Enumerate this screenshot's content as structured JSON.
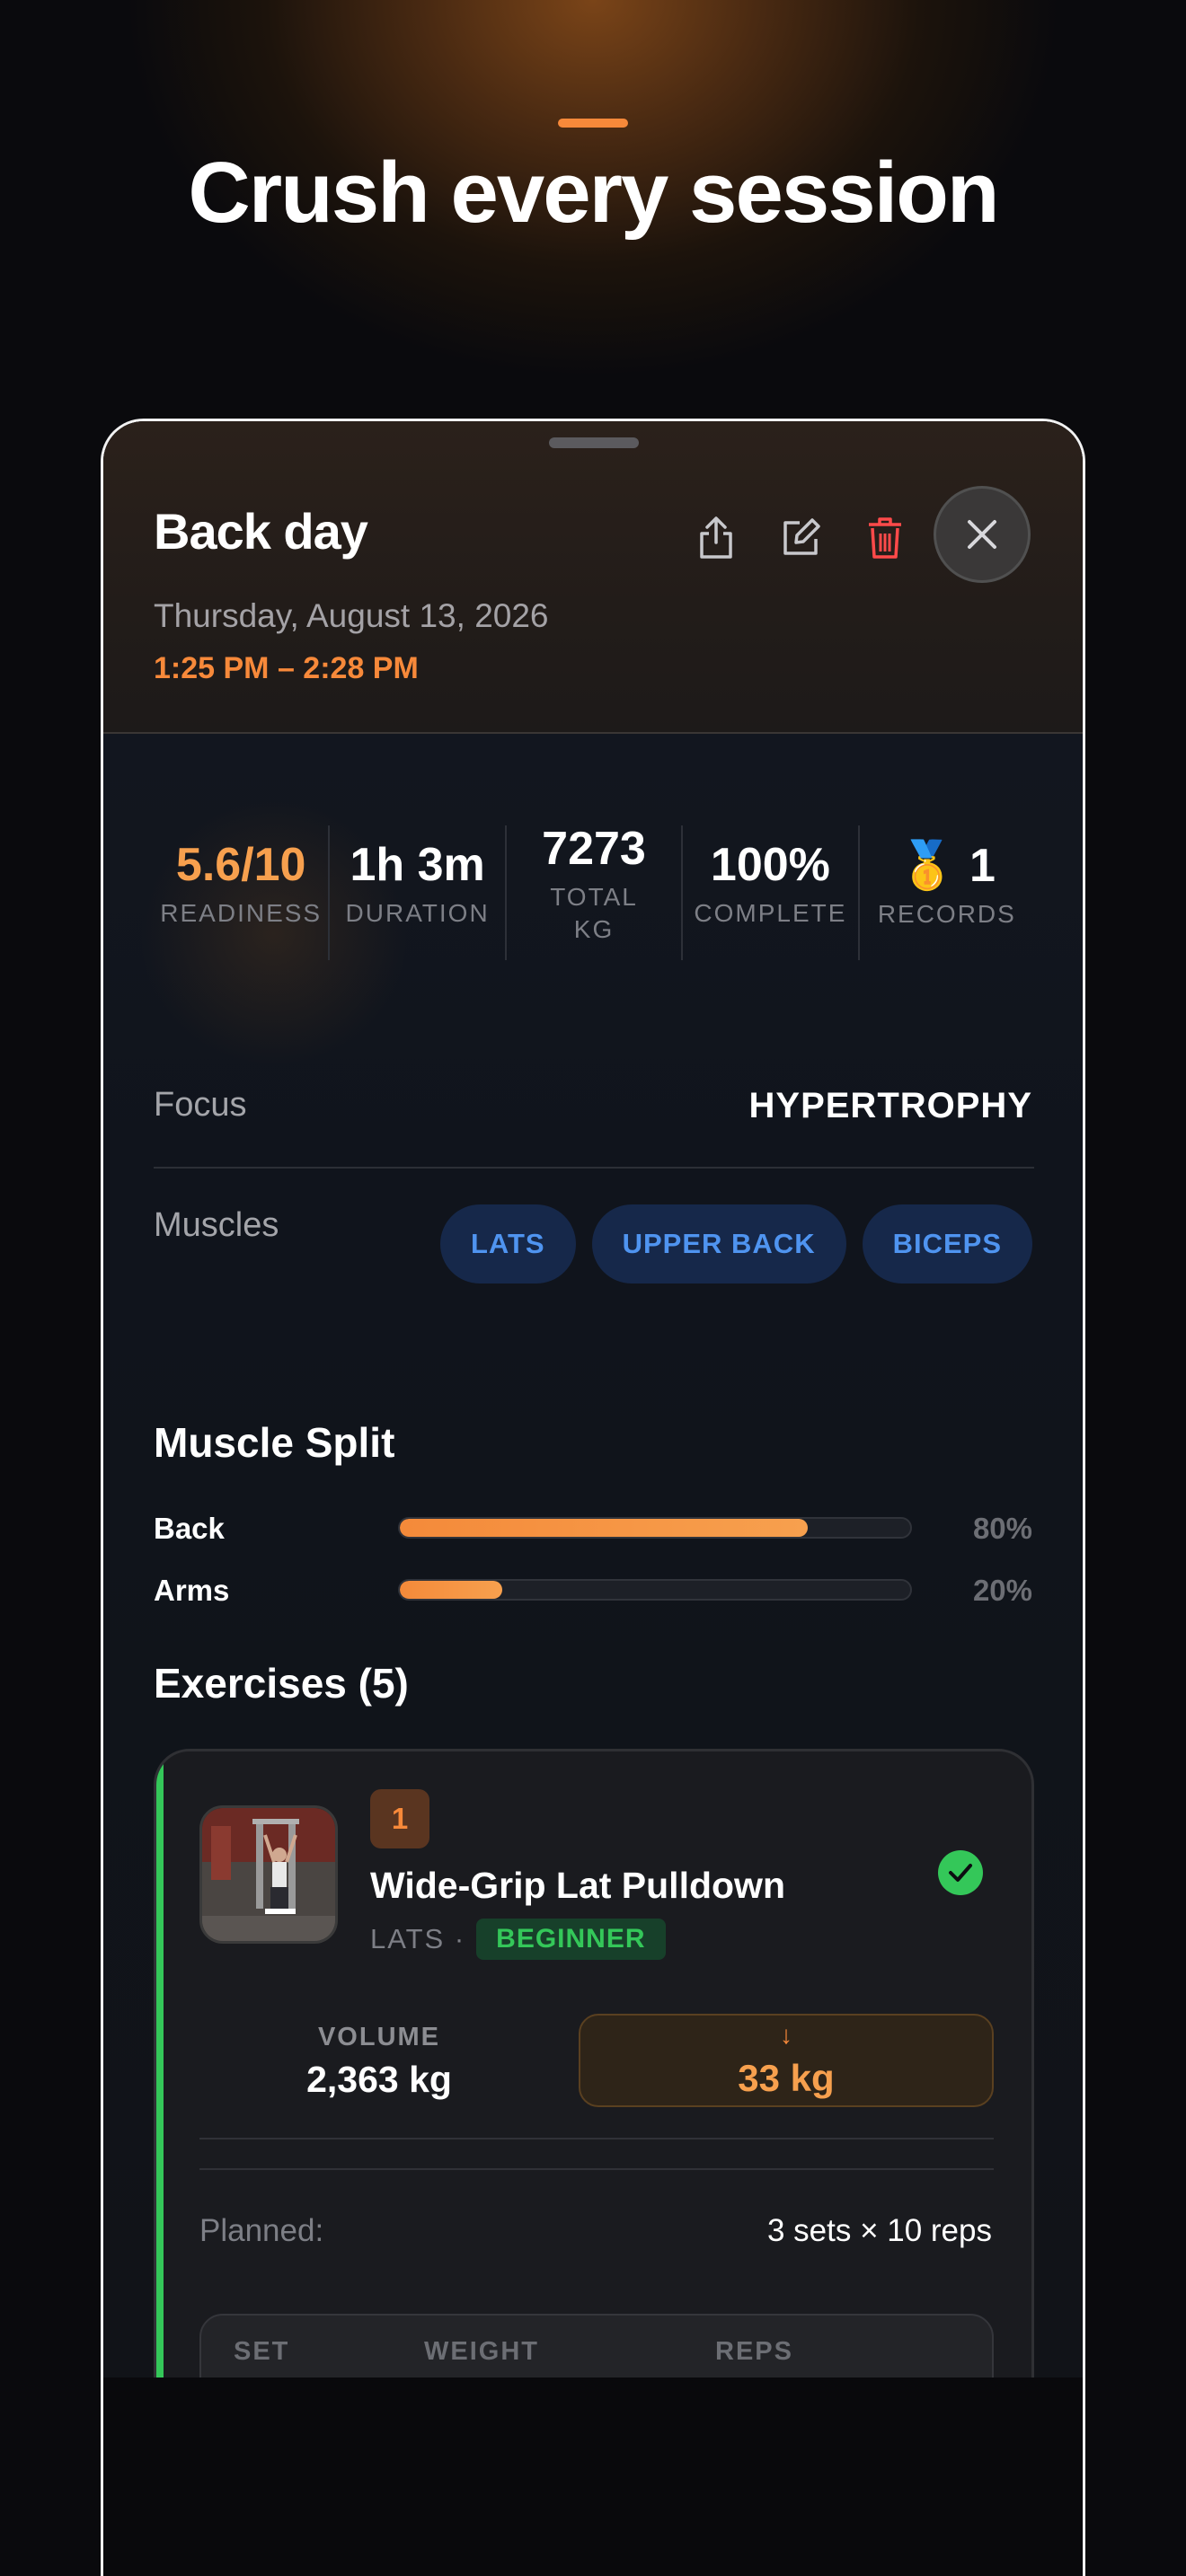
{
  "hero": {
    "title": "Crush every session"
  },
  "workout": {
    "title": "Back day",
    "date": "Thursday, August 13, 2026",
    "time": "1:25 PM – 2:28 PM"
  },
  "header_actions": [
    {
      "icon": "share-icon"
    },
    {
      "icon": "edit-icon"
    },
    {
      "icon": "trash-icon"
    },
    {
      "icon": "close-icon"
    }
  ],
  "stats": {
    "readiness": {
      "value": "5.6/10",
      "label": "READINESS"
    },
    "duration": {
      "value": "1h 3m",
      "label": "DURATION"
    },
    "total": {
      "value": "7273",
      "label": "TOTAL KG"
    },
    "complete": {
      "value": "100%",
      "label": "COMPLETE"
    },
    "records": {
      "value": "🥇 1",
      "label": "RECORDS"
    }
  },
  "focus": {
    "label": "Focus",
    "value": "HYPERTROPHY"
  },
  "muscles": {
    "label": "Muscles",
    "chips": [
      "LATS",
      "UPPER BACK",
      "BICEPS"
    ]
  },
  "muscle_split": {
    "title": "Muscle Split",
    "items": [
      {
        "label": "Back",
        "pct_text": "80%",
        "fraction": 0.8
      },
      {
        "label": "Arms",
        "pct_text": "20%",
        "fraction": 0.2
      }
    ]
  },
  "exercises": {
    "title": "Exercises (5)",
    "items": [
      {
        "number": "1",
        "name": "Wide-Grip Lat Pulldown",
        "muscle": "LATS ·",
        "level": "BEGINNER",
        "volume_label": "VOLUME",
        "volume_value": "2,363 kg",
        "best_arrow": "↓",
        "best_value": "33 kg",
        "planned_label": "Planned:",
        "planned_value": "3 sets × 10 reps",
        "table_headers": [
          "SET",
          "WEIGHT",
          "REPS"
        ]
      }
    ]
  },
  "colors": {
    "accent_orange": "#f7893a",
    "success_green": "#34c759",
    "chip_blue": "#4f94f0",
    "danger_red": "#ff4a4a"
  }
}
